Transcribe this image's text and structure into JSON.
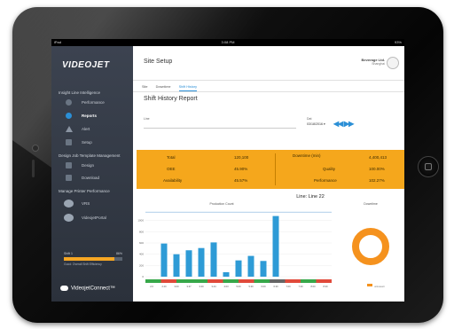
{
  "status": {
    "carrier": "iPad",
    "time": "3:08 PM",
    "battery": "93%"
  },
  "sidebar": {
    "logo": "VIDEOJET",
    "section1": "Insight Line Intelligence",
    "items1": [
      {
        "label": "Performance",
        "icon": "gauge-icon"
      },
      {
        "label": "Reports",
        "icon": "reports-icon"
      },
      {
        "label": "Alert",
        "icon": "alert-icon"
      },
      {
        "label": "Setup",
        "icon": "setup-icon"
      }
    ],
    "section2": "Design Job Template Management",
    "items2": [
      {
        "label": "Design",
        "icon": "design-icon"
      },
      {
        "label": "Download",
        "icon": "download-icon"
      }
    ],
    "section3": "Manage Printer Performance",
    "items3": [
      {
        "label": "VRS",
        "icon": "vrs-icon"
      },
      {
        "label": "VideojetPortal",
        "icon": "portal-icon"
      }
    ],
    "progress": {
      "label": "Shift 1",
      "value": 0.86,
      "percent": "86%",
      "sub": "Good: Overall Shift Efficiency"
    },
    "footer": "VideojetConnect™"
  },
  "header": {
    "title": "Site Setup",
    "user": "Beverage Ltd.",
    "user_sub": "Shanghai"
  },
  "tabs": [
    "Site",
    "Downtime",
    "Shift History"
  ],
  "report": {
    "title": "Shift History Report",
    "line_label": "Line",
    "line_value": "Line: 1",
    "date_label": "Dat",
    "date_value": "03/18/2016 ▾"
  },
  "kpi": {
    "left": [
      {
        "label": "Total",
        "value": "120,100"
      },
      {
        "label": "OEE",
        "value": "45.90%"
      },
      {
        "label": "Availability",
        "value": "45.57%"
      }
    ],
    "right": [
      {
        "label": "Downtime (min)",
        "value": "4,400,413"
      },
      {
        "label": "Quality",
        "value": "100.00%"
      },
      {
        "label": "Performance",
        "value": "102.27%"
      }
    ]
  },
  "chart_data": {
    "type": "bar",
    "title": "Line: Line 22",
    "subtitle": "Production Count",
    "categories": [
      "00:00",
      "00:30",
      "01:00",
      "01:30",
      "02:00",
      "02:30",
      "03:00",
      "03:30",
      "04:00",
      "04:30",
      "05:00",
      "05:30",
      "06:00",
      "06:30",
      "07:00"
    ],
    "tick_labels": [
      "2.0",
      "2.20",
      "3.00",
      "3.37",
      "3.30",
      "3.44",
      "4.03",
      "5.00",
      "5.30",
      "6.00",
      "6.30",
      "7.00",
      "7.30",
      "8.00",
      "8.30"
    ],
    "values": [
      0,
      590,
      400,
      470,
      510,
      610,
      80,
      290,
      370,
      280,
      1080,
      0,
      0,
      0,
      0
    ],
    "ylim": [
      0,
      1200
    ],
    "yticks": [
      0,
      200,
      400,
      600,
      800,
      1000
    ],
    "target_line": 1150,
    "timeline_colors": [
      "#37a84a",
      "#e04a3a",
      "#37a84a",
      "#37a84a",
      "#e04a3a",
      "#37a84a",
      "#e04a3a",
      "#37a84a",
      "#666666",
      "#e04a3a",
      "#37a84a",
      "#e04a3a"
    ],
    "donut": {
      "title": "Downtime",
      "value": 1.0,
      "color": "#f5921e",
      "legend": "unknown"
    }
  }
}
